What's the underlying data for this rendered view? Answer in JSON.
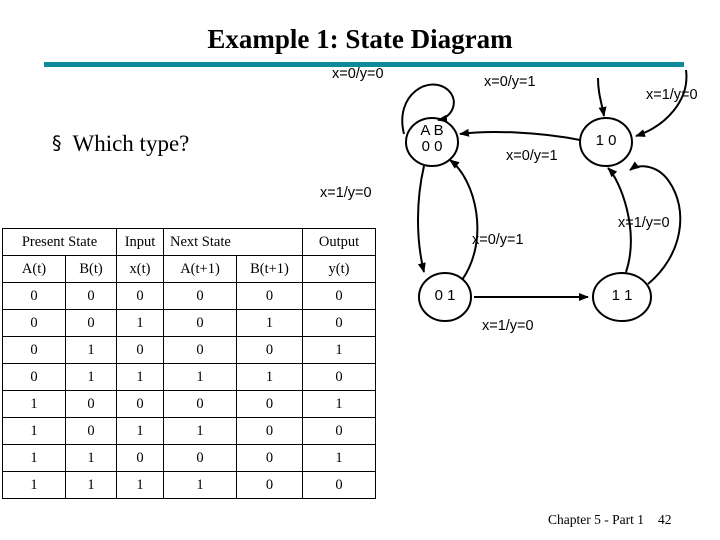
{
  "slide": {
    "title": "Example 1: State Diagram",
    "bullet_mark": "§",
    "bullet_text": "Which type?",
    "accent_color": "#0f8a99"
  },
  "table": {
    "headers": {
      "present_state": "Present State",
      "input": "Input",
      "next_state": "Next State",
      "output": "Output"
    },
    "subheaders": {
      "a_t": "A(t)",
      "b_t": "B(t)",
      "x_t": "x(t)",
      "a_t1": "A(t+1)",
      "b_t1": "B(t+1)",
      "y_t": "y(t)"
    },
    "rows": [
      {
        "a": "0",
        "b": "0",
        "x": "0",
        "an": "0",
        "bn": "0",
        "y": "0"
      },
      {
        "a": "0",
        "b": "0",
        "x": "1",
        "an": "0",
        "bn": "1",
        "y": "0"
      },
      {
        "a": "0",
        "b": "1",
        "x": "0",
        "an": "0",
        "bn": "0",
        "y": "1"
      },
      {
        "a": "0",
        "b": "1",
        "x": "1",
        "an": "1",
        "bn": "1",
        "y": "0"
      },
      {
        "a": "1",
        "b": "0",
        "x": "0",
        "an": "0",
        "bn": "0",
        "y": "1"
      },
      {
        "a": "1",
        "b": "0",
        "x": "1",
        "an": "1",
        "bn": "0",
        "y": "0"
      },
      {
        "a": "1",
        "b": "1",
        "x": "0",
        "an": "0",
        "bn": "0",
        "y": "1"
      },
      {
        "a": "1",
        "b": "1",
        "x": "1",
        "an": "1",
        "bn": "0",
        "y": "0"
      }
    ]
  },
  "diagram": {
    "states": [
      {
        "id": "s00",
        "header": "A B",
        "value": "0 0"
      },
      {
        "id": "s10",
        "header": "",
        "value": "1 0"
      },
      {
        "id": "s01",
        "header": "",
        "value": "0 1"
      },
      {
        "id": "s11",
        "header": "",
        "value": "1 1"
      }
    ],
    "edge_labels": [
      {
        "id": "e-top-left",
        "text": "x=0/y=0"
      },
      {
        "id": "e-top-mid",
        "text": "x=0/y=1"
      },
      {
        "id": "e-top-right",
        "text": "x=1/y=0"
      },
      {
        "id": "e-mid-00-10",
        "text": "x=0/y=1"
      },
      {
        "id": "e-left-down",
        "text": "x=1/y=0"
      },
      {
        "id": "e-right-up",
        "text": "x=1/y=0"
      },
      {
        "id": "e-center",
        "text": "x=0/y=1"
      },
      {
        "id": "e-bottom",
        "text": "x=1/y=0"
      }
    ]
  },
  "footer": {
    "text": "Chapter 5 - Part 1",
    "page": "42"
  }
}
